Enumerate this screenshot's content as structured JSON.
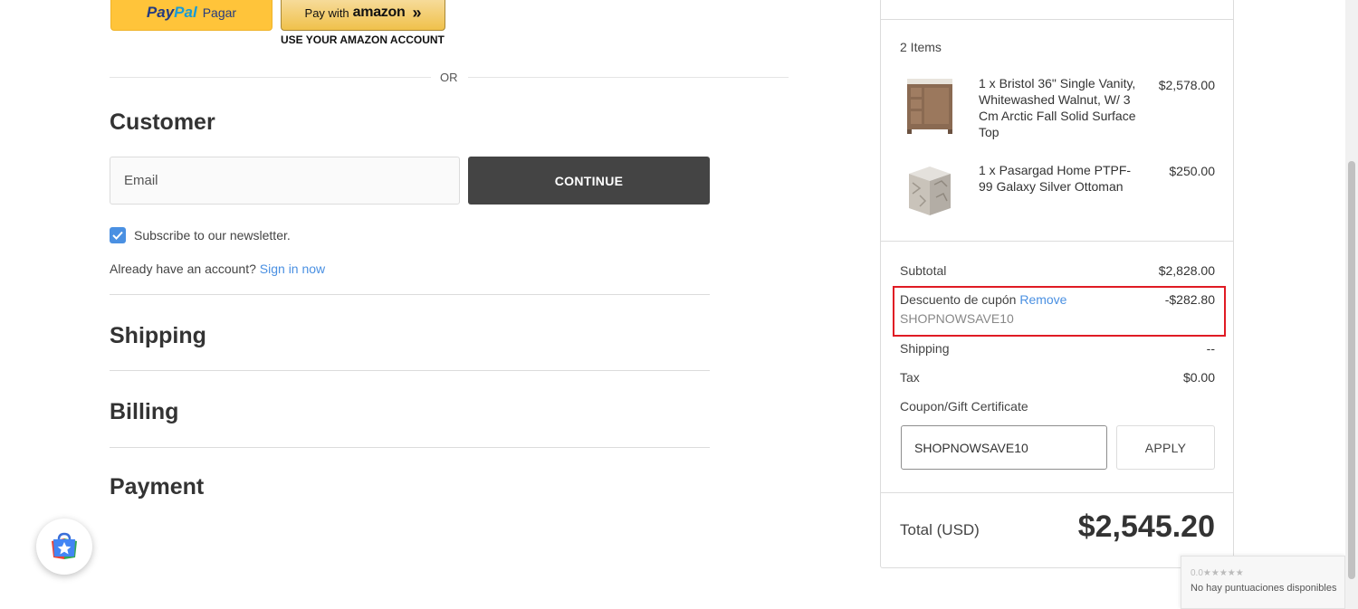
{
  "express": {
    "paypal_logo_a": "Pay",
    "paypal_logo_b": "Pal",
    "paypal_text": "Pagar",
    "amazon_prefix": "Pay with",
    "amazon_word": "amazon",
    "amazon_caption": "USE YOUR AMAZON ACCOUNT",
    "or_label": "OR"
  },
  "customer": {
    "title": "Customer",
    "email_placeholder": "Email",
    "email_value": "",
    "continue_label": "CONTINUE",
    "subscribe_checked": true,
    "subscribe_label": "Subscribe to our newsletter.",
    "account_prompt": "Already have an account?",
    "sign_in_label": "Sign in now"
  },
  "steps": {
    "shipping": "Shipping",
    "billing": "Billing",
    "payment": "Payment"
  },
  "summary": {
    "items_count": "2 Items",
    "items": [
      {
        "name": "1 x Bristol 36\" Single Vanity, Whitewashed Walnut, W/ 3 Cm Arctic Fall Solid Surface Top",
        "price": "$2,578.00",
        "icon": "vanity-image"
      },
      {
        "name": "1 x Pasargad Home PTPF-99 Galaxy Silver Ottoman",
        "price": "$250.00",
        "icon": "ottoman-image"
      }
    ],
    "subtotal_label": "Subtotal",
    "subtotal_value": "$2,828.00",
    "discount_label": "Descuento de cupón",
    "discount_remove": "Remove",
    "discount_value": "-$282.80",
    "coupon_applied": "SHOPNOWSAVE10",
    "shipping_label": "Shipping",
    "shipping_value": "--",
    "tax_label": "Tax",
    "tax_value": "$0.00",
    "coupon_link": "Coupon/Gift Certificate",
    "coupon_input_value": "SHOPNOWSAVE10",
    "apply_label": "APPLY",
    "total_label": "Total (USD)",
    "total_value": "$2,545.20",
    "highlight_color": "#e01b24"
  },
  "widgets": {
    "rating_score": "0.0",
    "rating_stars": "★★★★★",
    "rating_text": "No hay puntuaciones disponibles",
    "fab_icon": "shopping-bag-star-icon"
  },
  "colors": {
    "accent": "#4a90e2",
    "button_dark": "#444444",
    "paypal_yellow": "#ffc43a"
  }
}
